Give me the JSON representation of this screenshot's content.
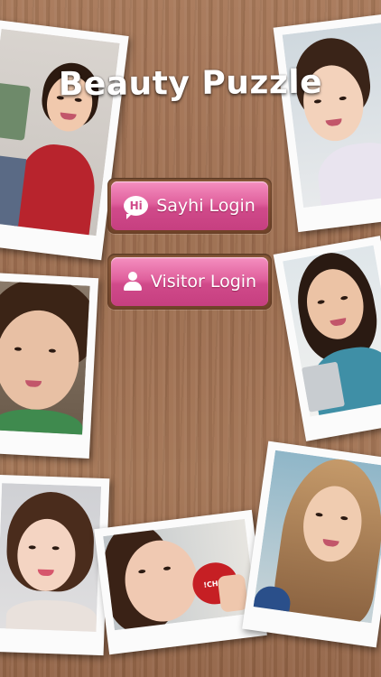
{
  "app": {
    "title": "Beauty Puzzle"
  },
  "buttons": {
    "sayhi": {
      "icon": "hi-chat-icon",
      "icon_text": "Hi",
      "label": "Sayhi Login"
    },
    "visitor": {
      "icon": "user-icon",
      "label": "Visitor Login"
    }
  },
  "photos": [
    {
      "name": "photo-woman-red-sweater"
    },
    {
      "name": "photo-woman-smiling-top-right"
    },
    {
      "name": "photo-woman-close-up"
    },
    {
      "name": "photo-woman-on-phone"
    },
    {
      "name": "photo-woman-bob-hair"
    },
    {
      "name": "photo-woman-apple"
    },
    {
      "name": "photo-woman-long-hair"
    }
  ],
  "photo_texts": {
    "apple_label": "!CHU!"
  },
  "colors": {
    "button_pink": "#e0609d",
    "wood": "#a8795a",
    "title_text": "#ffffff"
  }
}
